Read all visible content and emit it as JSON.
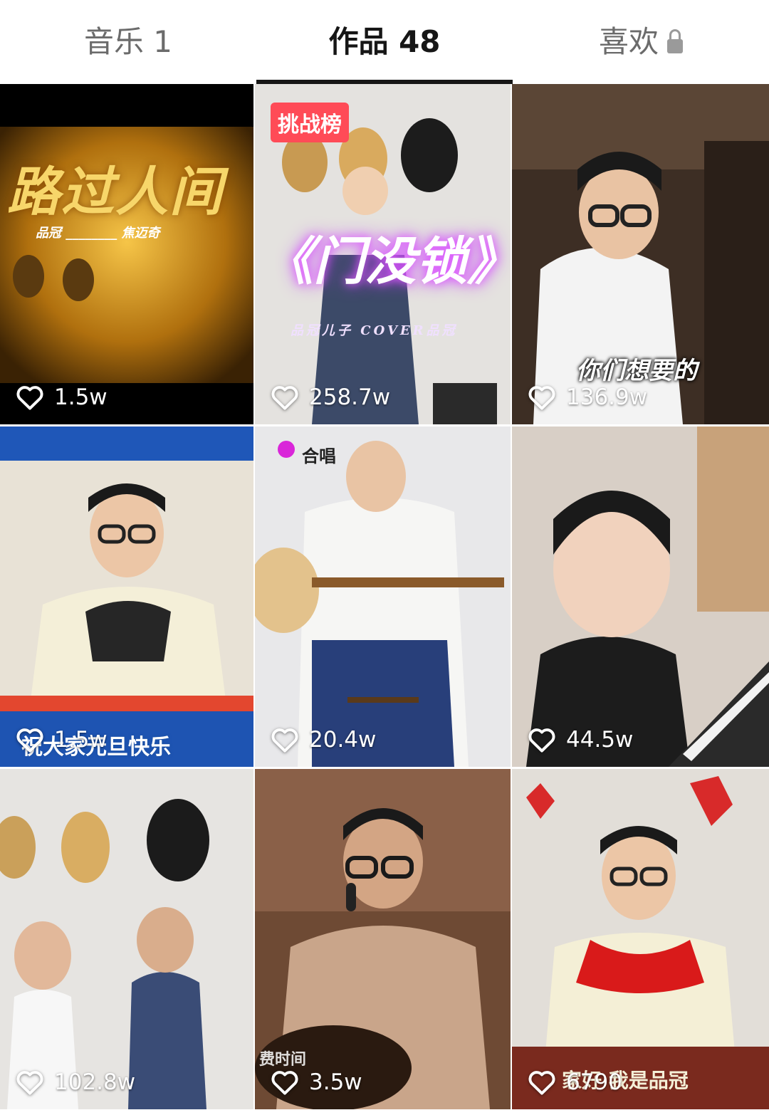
{
  "tabs": [
    {
      "label": "音乐 1",
      "active": false
    },
    {
      "label": "作品 48",
      "active": true
    },
    {
      "label": "喜欢",
      "active": false,
      "locked": true
    }
  ],
  "videos": [
    {
      "likes": "1.5w",
      "title": "路过人间",
      "subtitle": "品冠 ________ 焦迈奇"
    },
    {
      "likes": "258.7w",
      "badge": "挑战榜",
      "title": "《门没锁》",
      "subtitle": "品冠儿子 COVER品冠"
    },
    {
      "likes": "136.9w",
      "caption": "你们想要的"
    },
    {
      "likes": "1.5w",
      "caption": "祝大家元旦快乐"
    },
    {
      "likes": "20.4w",
      "chip": "合唱"
    },
    {
      "likes": "44.5w"
    },
    {
      "likes": "102.8w"
    },
    {
      "likes": "3.5w",
      "caption": "费时间"
    },
    {
      "likes": "6790",
      "caption": "家好  我是品冠"
    }
  ],
  "colors": {
    "accent": "#161616",
    "badge": "#ff4b57"
  }
}
